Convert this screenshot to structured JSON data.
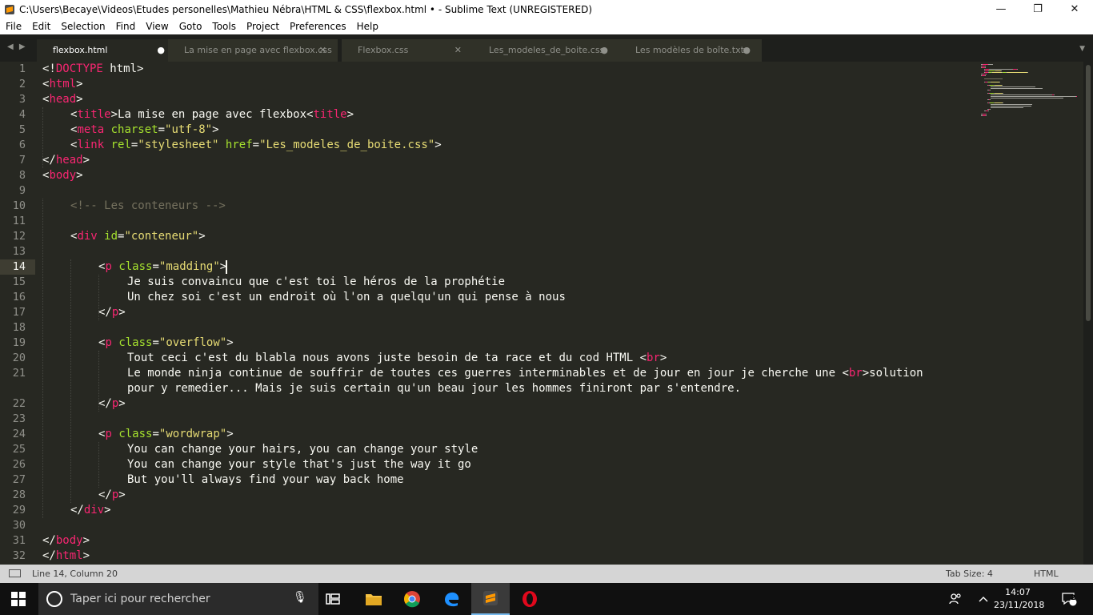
{
  "window": {
    "title": "C:\\Users\\Becaye\\Videos\\Etudes personelles\\Mathieu Nébra\\HTML & CSS\\flexbox.html • - Sublime Text (UNREGISTERED)",
    "controls": {
      "minimize": "—",
      "maximize": "❐",
      "close": "✕"
    }
  },
  "menu": [
    "File",
    "Edit",
    "Selection",
    "Find",
    "View",
    "Goto",
    "Tools",
    "Project",
    "Preferences",
    "Help"
  ],
  "tabs": [
    {
      "label": "flexbox.html",
      "close": "●",
      "active": true
    },
    {
      "label": "La mise en page avec flexbox.css",
      "close": "✕",
      "active": false
    },
    {
      "label": "Flexbox.css",
      "close": "✕",
      "active": false
    },
    {
      "label": "Les_modeles_de_boite.css",
      "close": "●",
      "active": false
    },
    {
      "label": "Les modèles de boîte.txt",
      "close": "●",
      "active": false
    }
  ],
  "editor": {
    "line_numbers": [
      "1",
      "2",
      "3",
      "4",
      "5",
      "6",
      "7",
      "8",
      "9",
      "10",
      "11",
      "12",
      "13",
      "14",
      "15",
      "16",
      "17",
      "18",
      "19",
      "20",
      "21",
      "",
      "22",
      "23",
      "24",
      "25",
      "26",
      "27",
      "28",
      "29",
      "30",
      "31",
      "32"
    ],
    "current_line": "14",
    "lines": [
      {
        "indent": 0,
        "parts": [
          {
            "t": "<!",
            "c": ""
          },
          {
            "t": "DOCTYPE",
            "c": "tg"
          },
          {
            "t": " html>",
            "c": ""
          }
        ]
      },
      {
        "indent": 0,
        "parts": [
          {
            "t": "<",
            "c": ""
          },
          {
            "t": "html",
            "c": "tg"
          },
          {
            "t": ">",
            "c": ""
          }
        ]
      },
      {
        "indent": 0,
        "parts": [
          {
            "t": "<",
            "c": ""
          },
          {
            "t": "head",
            "c": "tg"
          },
          {
            "t": ">",
            "c": ""
          }
        ]
      },
      {
        "indent": 1,
        "parts": [
          {
            "t": "<",
            "c": ""
          },
          {
            "t": "title",
            "c": "tg"
          },
          {
            "t": ">La mise en page avec flexbox<",
            "c": ""
          },
          {
            "t": "title",
            "c": "tg"
          },
          {
            "t": ">",
            "c": ""
          }
        ]
      },
      {
        "indent": 1,
        "parts": [
          {
            "t": "<",
            "c": ""
          },
          {
            "t": "meta",
            "c": "tg"
          },
          {
            "t": " ",
            "c": ""
          },
          {
            "t": "charset",
            "c": "at"
          },
          {
            "t": "=",
            "c": ""
          },
          {
            "t": "\"utf-8\"",
            "c": "st"
          },
          {
            "t": ">",
            "c": ""
          }
        ]
      },
      {
        "indent": 1,
        "parts": [
          {
            "t": "<",
            "c": ""
          },
          {
            "t": "link",
            "c": "tg"
          },
          {
            "t": " ",
            "c": ""
          },
          {
            "t": "rel",
            "c": "at"
          },
          {
            "t": "=",
            "c": ""
          },
          {
            "t": "\"stylesheet\"",
            "c": "st"
          },
          {
            "t": " ",
            "c": ""
          },
          {
            "t": "href",
            "c": "at"
          },
          {
            "t": "=",
            "c": ""
          },
          {
            "t": "\"Les_modeles_de_boite.css\"",
            "c": "st"
          },
          {
            "t": ">",
            "c": ""
          }
        ]
      },
      {
        "indent": 0,
        "parts": [
          {
            "t": "</",
            "c": ""
          },
          {
            "t": "head",
            "c": "tg"
          },
          {
            "t": ">",
            "c": ""
          }
        ]
      },
      {
        "indent": 0,
        "parts": [
          {
            "t": "<",
            "c": ""
          },
          {
            "t": "body",
            "c": "tg"
          },
          {
            "t": ">",
            "c": ""
          }
        ]
      },
      {
        "indent": 0,
        "parts": []
      },
      {
        "indent": 1,
        "parts": [
          {
            "t": "<!-- Les conteneurs -->",
            "c": "cm"
          }
        ]
      },
      {
        "indent": 0,
        "parts": []
      },
      {
        "indent": 1,
        "parts": [
          {
            "t": "<",
            "c": ""
          },
          {
            "t": "div",
            "c": "tg"
          },
          {
            "t": " ",
            "c": ""
          },
          {
            "t": "id",
            "c": "at"
          },
          {
            "t": "=",
            "c": ""
          },
          {
            "t": "\"conteneur\"",
            "c": "st"
          },
          {
            "t": ">",
            "c": ""
          }
        ]
      },
      {
        "indent": 0,
        "parts": []
      },
      {
        "indent": 2,
        "parts": [
          {
            "t": "<",
            "c": ""
          },
          {
            "t": "p",
            "c": "tg"
          },
          {
            "t": " ",
            "c": ""
          },
          {
            "t": "class",
            "c": "at"
          },
          {
            "t": "=",
            "c": ""
          },
          {
            "t": "\"madding\"",
            "c": "st"
          },
          {
            "t": ">",
            "c": ""
          }
        ]
      },
      {
        "indent": 3,
        "parts": [
          {
            "t": "Je suis convaincu que c'est toi le héros de la prophétie",
            "c": ""
          }
        ]
      },
      {
        "indent": 3,
        "parts": [
          {
            "t": "Un chez soi c'est un endroit où l'on a quelqu'un qui pense à nous",
            "c": ""
          }
        ]
      },
      {
        "indent": 2,
        "parts": [
          {
            "t": "</",
            "c": ""
          },
          {
            "t": "p",
            "c": "tg"
          },
          {
            "t": ">",
            "c": ""
          }
        ]
      },
      {
        "indent": 0,
        "parts": []
      },
      {
        "indent": 2,
        "parts": [
          {
            "t": "<",
            "c": ""
          },
          {
            "t": "p",
            "c": "tg"
          },
          {
            "t": " ",
            "c": ""
          },
          {
            "t": "class",
            "c": "at"
          },
          {
            "t": "=",
            "c": ""
          },
          {
            "t": "\"overflow\"",
            "c": "st"
          },
          {
            "t": ">",
            "c": ""
          }
        ]
      },
      {
        "indent": 3,
        "parts": [
          {
            "t": "Tout ceci c'est du blabla nous avons juste besoin de ta race et du cod HTML <",
            "c": ""
          },
          {
            "t": "br",
            "c": "tg"
          },
          {
            "t": ">",
            "c": ""
          }
        ]
      },
      {
        "indent": 3,
        "parts": [
          {
            "t": "Le monde ninja continue de souffrir de toutes ces guerres interminables et de jour en jour je cherche une <",
            "c": ""
          },
          {
            "t": "br",
            "c": "tg"
          },
          {
            "t": ">solution",
            "c": ""
          }
        ]
      },
      {
        "indent": 3,
        "parts": [
          {
            "t": "pour y remedier... Mais je suis certain qu'un beau jour les hommes finiront par s'entendre.",
            "c": ""
          }
        ]
      },
      {
        "indent": 2,
        "parts": [
          {
            "t": "</",
            "c": ""
          },
          {
            "t": "p",
            "c": "tg"
          },
          {
            "t": ">",
            "c": ""
          }
        ]
      },
      {
        "indent": 0,
        "parts": []
      },
      {
        "indent": 2,
        "parts": [
          {
            "t": "<",
            "c": ""
          },
          {
            "t": "p",
            "c": "tg"
          },
          {
            "t": " ",
            "c": ""
          },
          {
            "t": "class",
            "c": "at"
          },
          {
            "t": "=",
            "c": ""
          },
          {
            "t": "\"wordwrap\"",
            "c": "st"
          },
          {
            "t": ">",
            "c": ""
          }
        ]
      },
      {
        "indent": 3,
        "parts": [
          {
            "t": "You can change your hairs, you can change your style",
            "c": ""
          }
        ]
      },
      {
        "indent": 3,
        "parts": [
          {
            "t": "You can change your style that's just the way it go",
            "c": ""
          }
        ]
      },
      {
        "indent": 3,
        "parts": [
          {
            "t": "But you'll always find your way back home",
            "c": ""
          }
        ]
      },
      {
        "indent": 2,
        "parts": [
          {
            "t": "</",
            "c": ""
          },
          {
            "t": "p",
            "c": "tg"
          },
          {
            "t": ">",
            "c": ""
          }
        ]
      },
      {
        "indent": 1,
        "parts": [
          {
            "t": "</",
            "c": ""
          },
          {
            "t": "div",
            "c": "tg"
          },
          {
            "t": ">",
            "c": ""
          }
        ]
      },
      {
        "indent": 0,
        "parts": []
      },
      {
        "indent": 0,
        "parts": [
          {
            "t": "</",
            "c": ""
          },
          {
            "t": "body",
            "c": "tg"
          },
          {
            "t": ">",
            "c": ""
          }
        ]
      },
      {
        "indent": 0,
        "parts": [
          {
            "t": "</",
            "c": ""
          },
          {
            "t": "html",
            "c": "tg"
          },
          {
            "t": ">",
            "c": ""
          }
        ]
      }
    ]
  },
  "status": {
    "position": "Line 14, Column 20",
    "tab_size": "Tab Size: 4",
    "syntax": "HTML"
  },
  "taskbar": {
    "search_placeholder": "Taper ici pour rechercher",
    "time": "14:07",
    "date": "23/11/2018",
    "notifications": "2"
  },
  "colors": {
    "editor_bg": "#272822",
    "tag": "#f92672",
    "attribute": "#a6e22e",
    "string": "#e6db74",
    "comment": "#75715e",
    "text": "#f8f8f2"
  }
}
